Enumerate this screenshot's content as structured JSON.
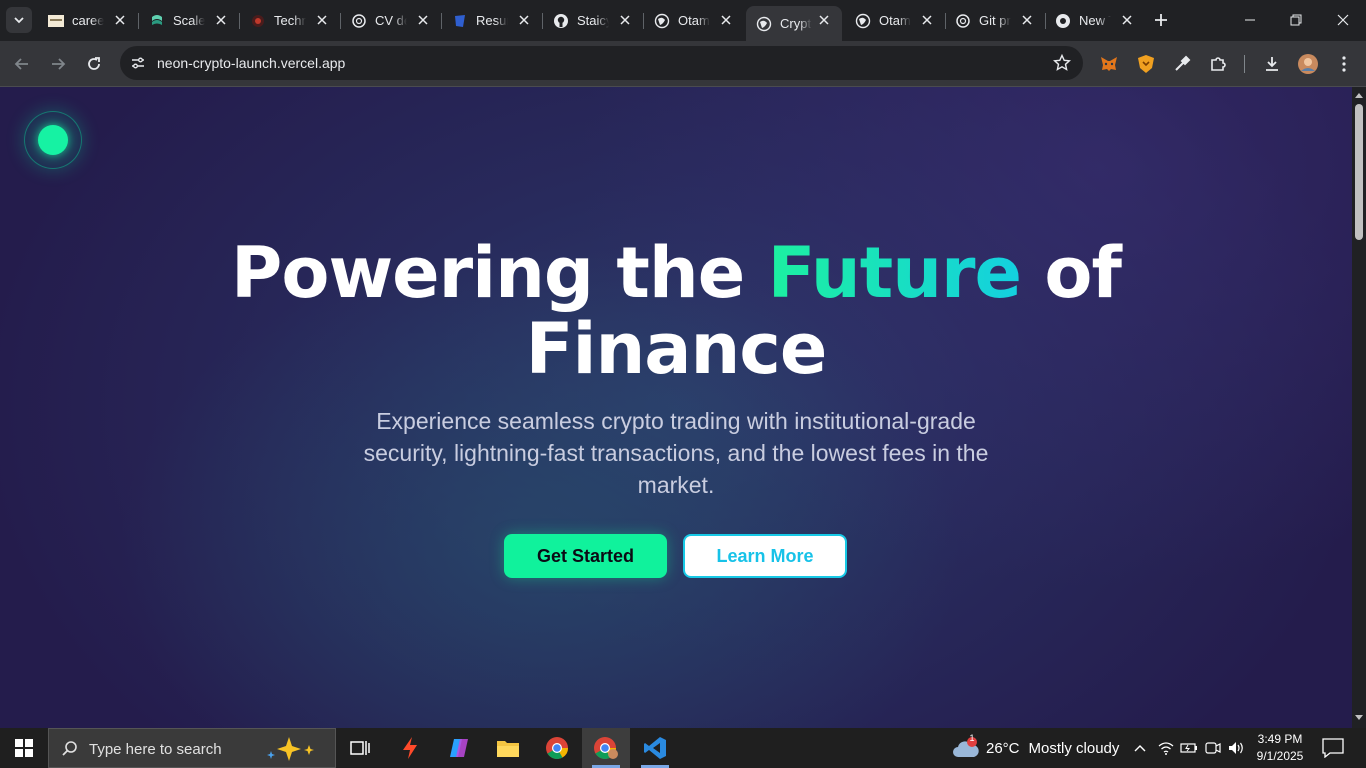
{
  "browser": {
    "tabs": [
      {
        "title": "careers",
        "favicon": "careers-favicon"
      },
      {
        "title": "Scale AI",
        "favicon": "scale-favicon"
      },
      {
        "title": "Technical",
        "favicon": "tech-favicon"
      },
      {
        "title": "CV design",
        "favicon": "openai-favicon"
      },
      {
        "title": "Resume",
        "favicon": "resume-favicon"
      },
      {
        "title": "Staicy",
        "favicon": "github-favicon"
      },
      {
        "title": "Otamo",
        "favicon": "globe-favicon"
      },
      {
        "title": "Crypto",
        "favicon": "globe-favicon",
        "active": true
      },
      {
        "title": "Otamo",
        "favicon": "globe-favicon"
      },
      {
        "title": "Git pr",
        "favicon": "openai-favicon"
      },
      {
        "title": "New Tab",
        "favicon": "chrome-favicon"
      }
    ],
    "url": "neon-crypto-launch.vercel.app"
  },
  "hero": {
    "title_part1": "Powering the ",
    "title_accent": "Future",
    "title_part2": " of",
    "title_line2": "Finance",
    "subtitle": "Experience seamless crypto trading with institutional-grade security, lightning-fast transactions, and the lowest fees in the market.",
    "primary_cta": "Get Started",
    "secondary_cta": "Learn More"
  },
  "colors": {
    "accent_green": "#10f29c",
    "accent_cyan": "#17c9e6",
    "page_bg": "#26204f"
  },
  "taskbar": {
    "search_placeholder": "Type here to search",
    "weather_temp": "26°C",
    "weather_desc": "Mostly cloudy",
    "weather_badge": "1",
    "time": "3:49 PM",
    "date": "9/1/2025"
  }
}
